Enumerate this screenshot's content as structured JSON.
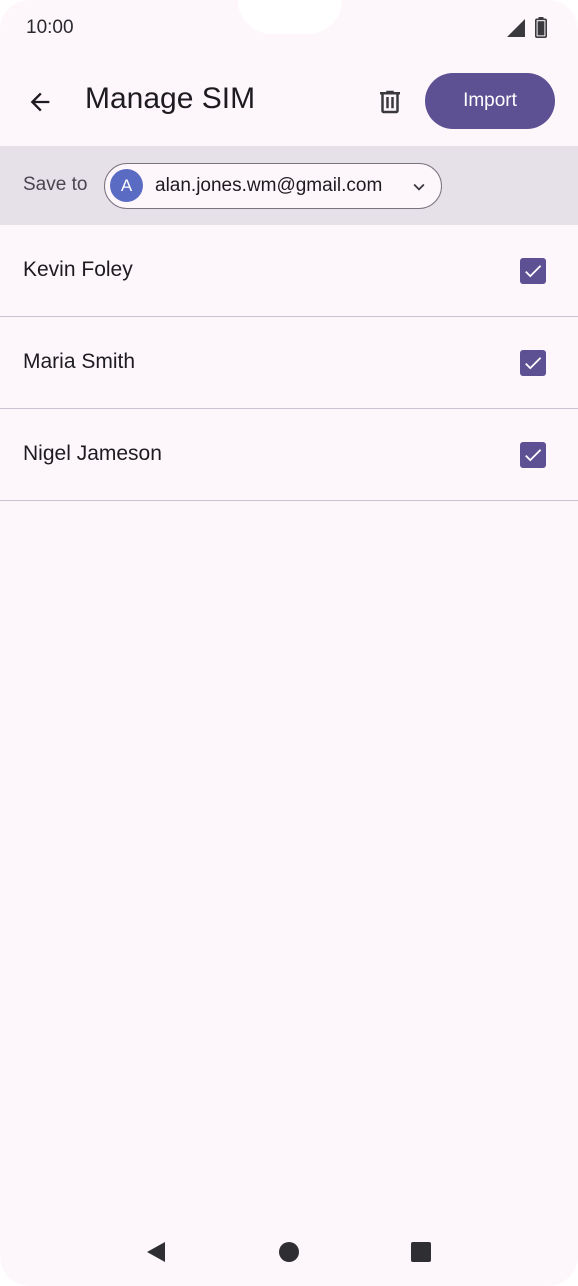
{
  "status_bar": {
    "time": "10:00",
    "icons": [
      "signal-icon",
      "battery-icon"
    ]
  },
  "toolbar": {
    "back_icon": "arrow-back-icon",
    "title": "Manage SIM",
    "delete_icon": "trash-icon",
    "import_label": "Import"
  },
  "save_bar": {
    "label": "Save to",
    "account": {
      "avatar_letter": "A",
      "avatar_color": "#5a6bc4",
      "email": "alan.jones.wm@gmail.com",
      "dropdown_icon": "chevron-down-icon"
    }
  },
  "contacts": [
    {
      "name": "Kevin Foley",
      "checked": true
    },
    {
      "name": "Maria Smith",
      "checked": true
    },
    {
      "name": "Nigel Jameson",
      "checked": true
    }
  ],
  "nav_bar": {
    "icons": [
      "nav-back-icon",
      "nav-home-icon",
      "nav-recents-icon"
    ]
  },
  "colors": {
    "background": "#fdf7fc",
    "accent": "#5e5193",
    "save_bar_bg": "#e6e0e9"
  }
}
